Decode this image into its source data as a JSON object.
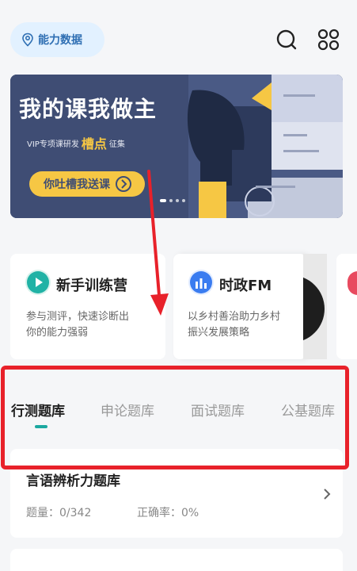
{
  "header": {
    "location_chip": "能力数据",
    "search_icon": "search-icon",
    "menu_icon": "grid-icon"
  },
  "banner": {
    "title": "我的课我做主",
    "sub_prefix": "VIP专项课研发",
    "sub_hot": "槽点",
    "sub_suffix": "征集",
    "button": "你吐槽我送课",
    "colors": {
      "bg": "#3f4d74",
      "accent": "#f6c744"
    }
  },
  "cards": [
    {
      "title": "新手训练营",
      "desc_line1": "参与测评，快速诊断出",
      "desc_line2": "你的能力强弱",
      "icon": "play-icon"
    },
    {
      "title": "时政FM",
      "desc_line1": "以乡村善治助力乡村",
      "desc_line2": "振兴发展策略",
      "icon": "audio-bars-icon"
    }
  ],
  "tabs": [
    {
      "label": "行测题库",
      "active": true
    },
    {
      "label": "申论题库",
      "active": false
    },
    {
      "label": "面试题库",
      "active": false
    },
    {
      "label": "公基题库",
      "active": false
    }
  ],
  "items": [
    {
      "title": "言语辨析力题库",
      "count_label": "题量：0/342",
      "accuracy_label": "正确率：0%"
    }
  ],
  "annotation": {
    "color": "#e8212a"
  }
}
